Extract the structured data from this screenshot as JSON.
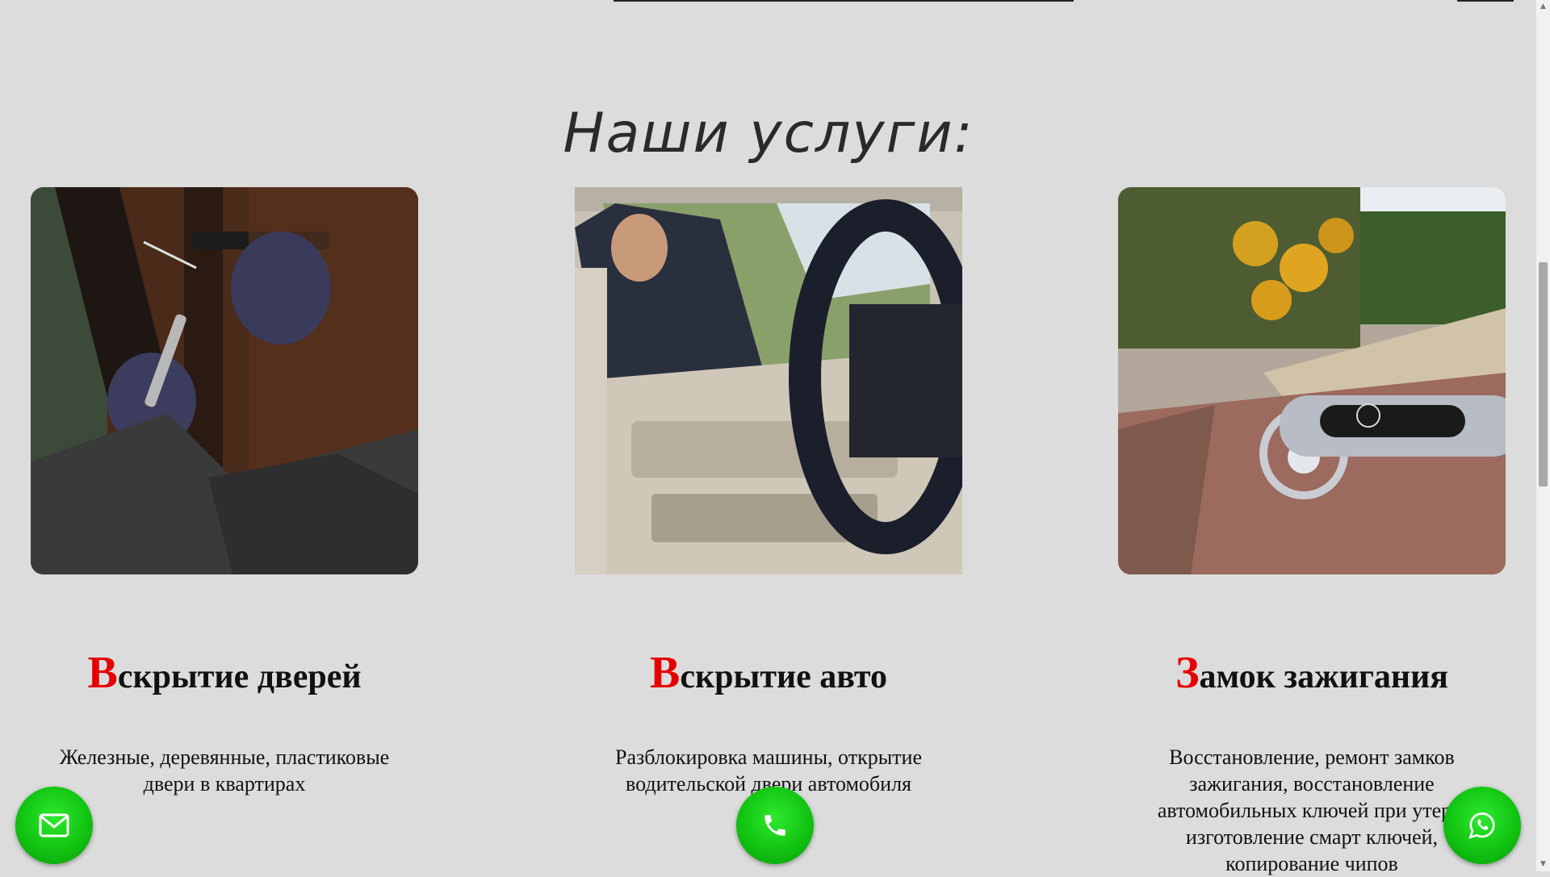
{
  "section": {
    "title": "Наши услуги:"
  },
  "cards": [
    {
      "image_alt": "door-lock-picking-photo",
      "title_cap": "В",
      "title_rest": "скрытие дверей",
      "text": "Железные, деревянные, пластиковые двери в квартирах"
    },
    {
      "image_alt": "car-door-opening-photo",
      "title_cap": "В",
      "title_rest": "скрытие авто",
      "text": "Разблокировка машины, открытие водительской двери автомобиля"
    },
    {
      "image_alt": "car-key-fob-photo",
      "title_cap": "З",
      "title_rest": "амок зажигания",
      "text": "Восстановление, ремонт замков зажигания, восстановление автомобильных ключей при утере, изготовление смарт ключей, копирование чипов"
    }
  ],
  "floating_buttons": {
    "mail_icon": "envelope-icon",
    "phone_icon": "phone-icon",
    "whatsapp_icon": "whatsapp-icon",
    "color": "#12c412"
  },
  "colors": {
    "background": "#dcdcdc",
    "accent_red": "#e60000",
    "text": "#111111"
  }
}
